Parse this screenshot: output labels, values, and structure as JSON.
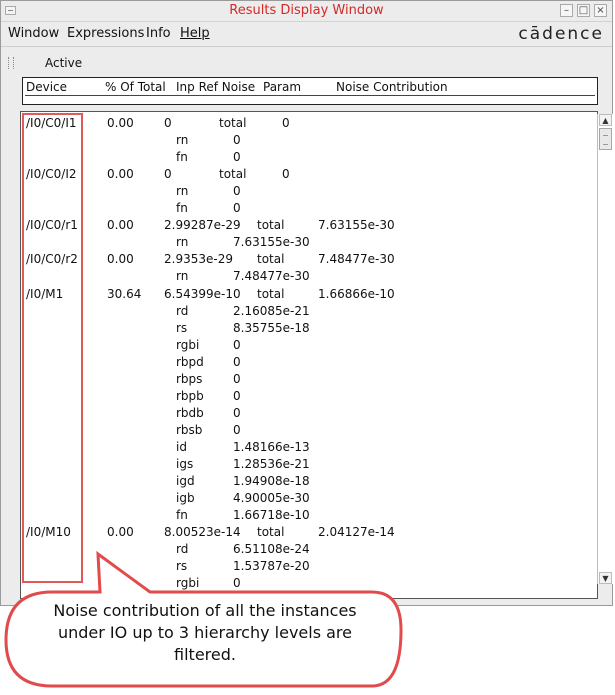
{
  "window": {
    "title": "Results Display Window",
    "brand": "cādence",
    "minimize_icon": "minimize-icon",
    "maximize_icon": "maximize-icon",
    "close_icon": "close-icon"
  },
  "menu": {
    "items": [
      "Window",
      "Expressions",
      "Info",
      "Help"
    ]
  },
  "toolbar": {
    "active_label": "Active"
  },
  "table": {
    "columns": [
      "Device",
      "% Of Total",
      "Inp Ref Noise",
      "Param",
      "Noise Contribution"
    ],
    "rows": [
      {
        "device": "/I0/C0/I1",
        "pct": "0.00",
        "inp": "0",
        "param": "total",
        "noise": "0"
      },
      {
        "device": "",
        "pct": "",
        "inp": "",
        "param": "rn",
        "noise": "0"
      },
      {
        "device": "",
        "pct": "",
        "inp": "",
        "param": "fn",
        "noise": "0"
      },
      {
        "device": "/I0/C0/I2",
        "pct": "0.00",
        "inp": "0",
        "param": "total",
        "noise": "0"
      },
      {
        "device": "",
        "pct": "",
        "inp": "",
        "param": "rn",
        "noise": "0"
      },
      {
        "device": "",
        "pct": "",
        "inp": "",
        "param": "fn",
        "noise": "0"
      },
      {
        "device": "/I0/C0/r1",
        "pct": "0.00",
        "inp": "2.99287e-29",
        "param": "total",
        "noise": "7.63155e-30"
      },
      {
        "device": "",
        "pct": "",
        "inp": "",
        "param": "rn",
        "noise": "7.63155e-30"
      },
      {
        "device": "/I0/C0/r2",
        "pct": "0.00",
        "inp": "2.9353e-29",
        "param": "total",
        "noise": "7.48477e-30"
      },
      {
        "device": "",
        "pct": "",
        "inp": "",
        "param": "rn",
        "noise": "7.48477e-30"
      },
      {
        "device": "/I0/M1",
        "pct": "30.64",
        "inp": "6.54399e-10",
        "param": "total",
        "noise": "1.66866e-10"
      },
      {
        "device": "",
        "pct": "",
        "inp": "",
        "param": "rd",
        "noise": "2.16085e-21"
      },
      {
        "device": "",
        "pct": "",
        "inp": "",
        "param": "rs",
        "noise": "8.35755e-18"
      },
      {
        "device": "",
        "pct": "",
        "inp": "",
        "param": "rgbi",
        "noise": "0"
      },
      {
        "device": "",
        "pct": "",
        "inp": "",
        "param": "rbpd",
        "noise": "0"
      },
      {
        "device": "",
        "pct": "",
        "inp": "",
        "param": "rbps",
        "noise": "0"
      },
      {
        "device": "",
        "pct": "",
        "inp": "",
        "param": "rbpb",
        "noise": "0"
      },
      {
        "device": "",
        "pct": "",
        "inp": "",
        "param": "rbdb",
        "noise": "0"
      },
      {
        "device": "",
        "pct": "",
        "inp": "",
        "param": "rbsb",
        "noise": "0"
      },
      {
        "device": "",
        "pct": "",
        "inp": "",
        "param": "id",
        "noise": "1.48166e-13"
      },
      {
        "device": "",
        "pct": "",
        "inp": "",
        "param": "igs",
        "noise": "1.28536e-21"
      },
      {
        "device": "",
        "pct": "",
        "inp": "",
        "param": "igd",
        "noise": "1.94908e-18"
      },
      {
        "device": "",
        "pct": "",
        "inp": "",
        "param": "igb",
        "noise": "4.90005e-30"
      },
      {
        "device": "",
        "pct": "",
        "inp": "",
        "param": "fn",
        "noise": "1.66718e-10"
      },
      {
        "device": "/I0/M10",
        "pct": "0.00",
        "inp": "8.00523e-14",
        "param": "total",
        "noise": "2.04127e-14"
      },
      {
        "device": "",
        "pct": "",
        "inp": "",
        "param": "rd",
        "noise": "6.51108e-24"
      },
      {
        "device": "",
        "pct": "",
        "inp": "",
        "param": "rs",
        "noise": "1.53787e-20"
      },
      {
        "device": "",
        "pct": "",
        "inp": "",
        "param": "rgbi",
        "noise": "0"
      }
    ]
  },
  "callout": {
    "text": "Noise contribution of all the instances under IO up to 3 hierarchy levels are filtered.",
    "border_color": "#e24b4b"
  }
}
